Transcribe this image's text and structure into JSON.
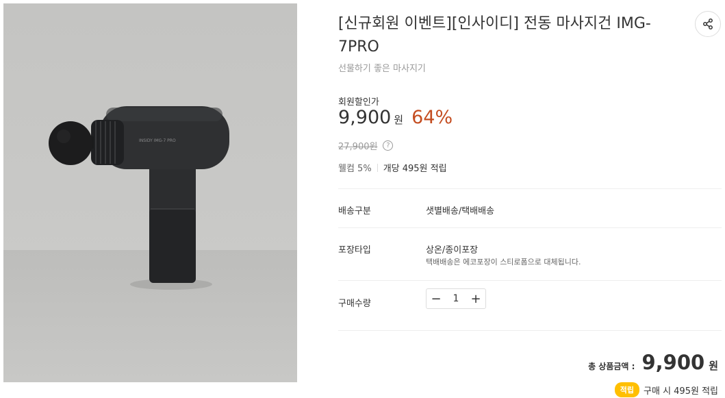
{
  "product": {
    "title": "[신규회원 이벤트][인사이디] 전동 마사지건 IMG-7PRO",
    "subtitle": "선물하기 좋은 마사지기",
    "image_alt": "INSIDY IMG-7 PRO massage gun"
  },
  "price": {
    "label": "회원할인가",
    "value": "9,900",
    "unit": "원",
    "discount": "64%",
    "original": "27,900원",
    "help_icon": "question-icon"
  },
  "reward": {
    "welcome": "웰컴 5%",
    "point": "개당 495원 적립"
  },
  "details": {
    "delivery_label": "배송구분",
    "delivery_value": "샛별배송/택배배송",
    "package_label": "포장타입",
    "package_value": "상온/종이포장",
    "package_note": "택배배송은 에코포장이 스티로폼으로 대체됩니다.",
    "quantity_label": "구매수량",
    "quantity": "1",
    "minus": "−",
    "plus": "+"
  },
  "total": {
    "label": "총 상품금액 :",
    "value": "9,900",
    "unit": "원"
  },
  "points": {
    "badge": "적립",
    "text": "구매 시 495원 적립"
  },
  "share_icon": "share-icon",
  "colors": {
    "discount": "#c44d21",
    "badge": "#ffbf00",
    "text": "#333333",
    "muted": "#999999"
  }
}
